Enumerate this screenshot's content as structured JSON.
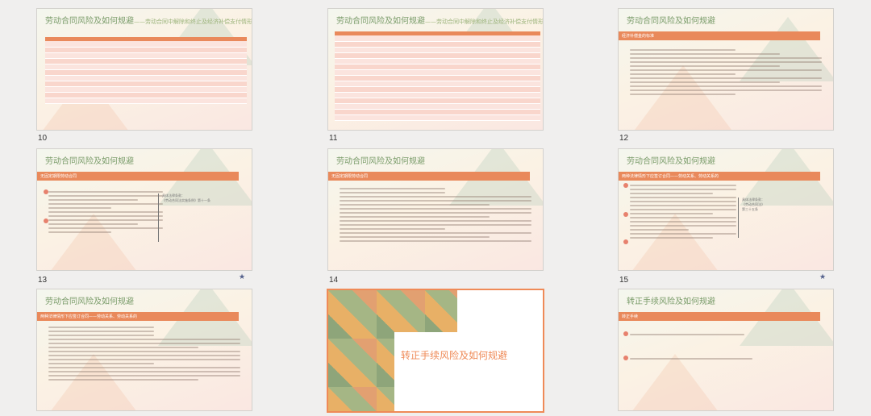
{
  "slides": [
    {
      "num": "10",
      "title": "劳动合同风险及如何规避",
      "subtitle": "——劳动合同中解除和终止及经济补偿支付情形",
      "bar": ""
    },
    {
      "num": "11",
      "title": "劳动合同风险及如何规避",
      "subtitle": "——劳动合同中解除和终止及经济补偿支付情形",
      "bar": ""
    },
    {
      "num": "12",
      "title": "劳动合同风险及如何规避",
      "subtitle": "",
      "bar": "经济补偿金的标准"
    },
    {
      "num": "13",
      "title": "劳动合同风险及如何规避",
      "subtitle": "",
      "bar": "无固定期限劳动合同"
    },
    {
      "num": "14",
      "title": "劳动合同风险及如何规避",
      "subtitle": "",
      "bar": "无固定期限劳动合同"
    },
    {
      "num": "15",
      "title": "劳动合同风险及如何规避",
      "subtitle": "",
      "bar": "两种法律情形下应签订合同——劳动关系、劳动关系的"
    },
    {
      "num": "",
      "title": "劳动合同风险及如何规避",
      "subtitle": "",
      "bar": "两种法律情形下应签订合同——劳动关系、劳动关系的"
    },
    {
      "num": "",
      "title": "转正手续风险及如何规避",
      "subtitle": "",
      "bar": ""
    },
    {
      "num": "",
      "title": "转正手续风险及如何规避",
      "subtitle": "",
      "bar": "转正手续"
    }
  ],
  "side_notes": {
    "s13": [
      "具体法律条款：",
      "《劳动合同法实施条例》第十一条"
    ],
    "s15": [
      "具体法律条款：",
      "《劳动合同法》",
      "第三十五条"
    ]
  },
  "icons": {
    "star": "star-icon"
  }
}
